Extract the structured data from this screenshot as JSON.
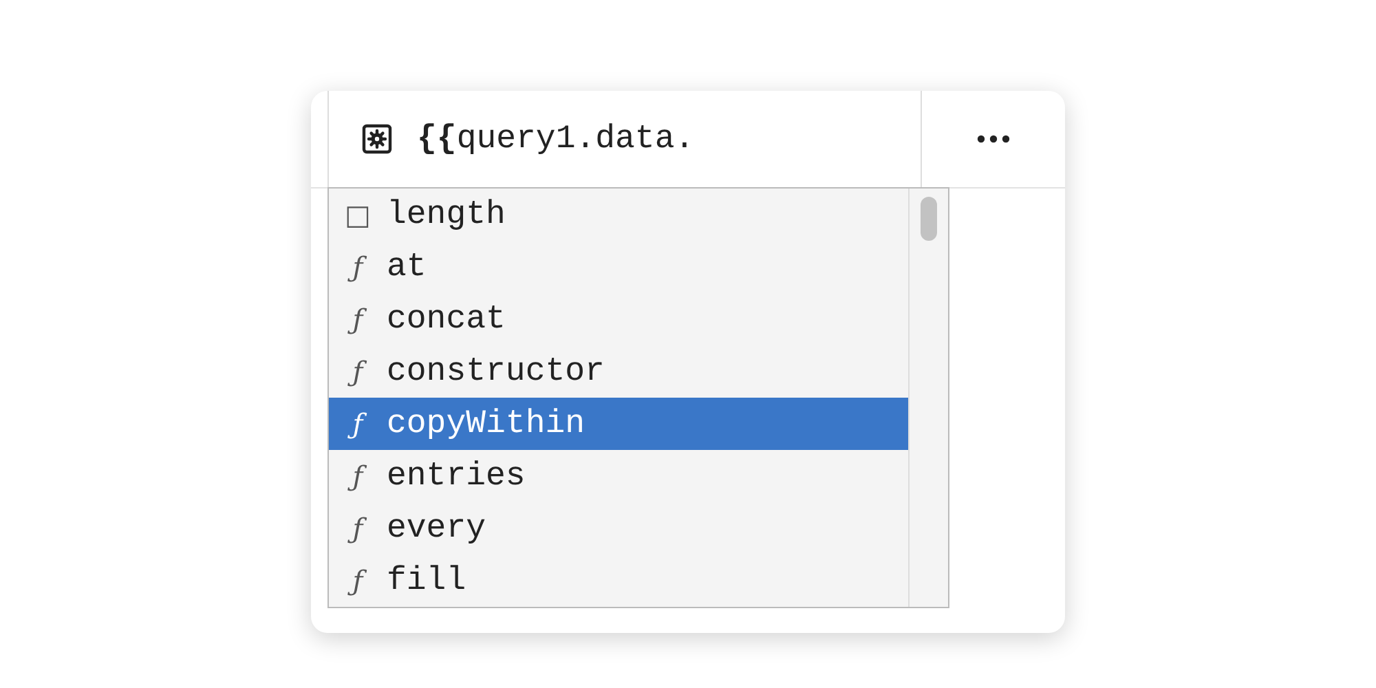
{
  "editor": {
    "value": "**{{**query1.data."
  },
  "autocomplete": {
    "items": [
      {
        "icon": "□",
        "label": "length",
        "selected": false
      },
      {
        "icon": "ƒ",
        "label": "at",
        "selected": false
      },
      {
        "icon": "ƒ",
        "label": "concat",
        "selected": false
      },
      {
        "icon": "ƒ",
        "label": "constructor",
        "selected": false
      },
      {
        "icon": "ƒ",
        "label": "copyWithin",
        "selected": true
      },
      {
        "icon": "ƒ",
        "label": "entries",
        "selected": false
      },
      {
        "icon": "ƒ",
        "label": "every",
        "selected": false
      },
      {
        "icon": "ƒ",
        "label": "fill",
        "selected": false
      }
    ]
  }
}
